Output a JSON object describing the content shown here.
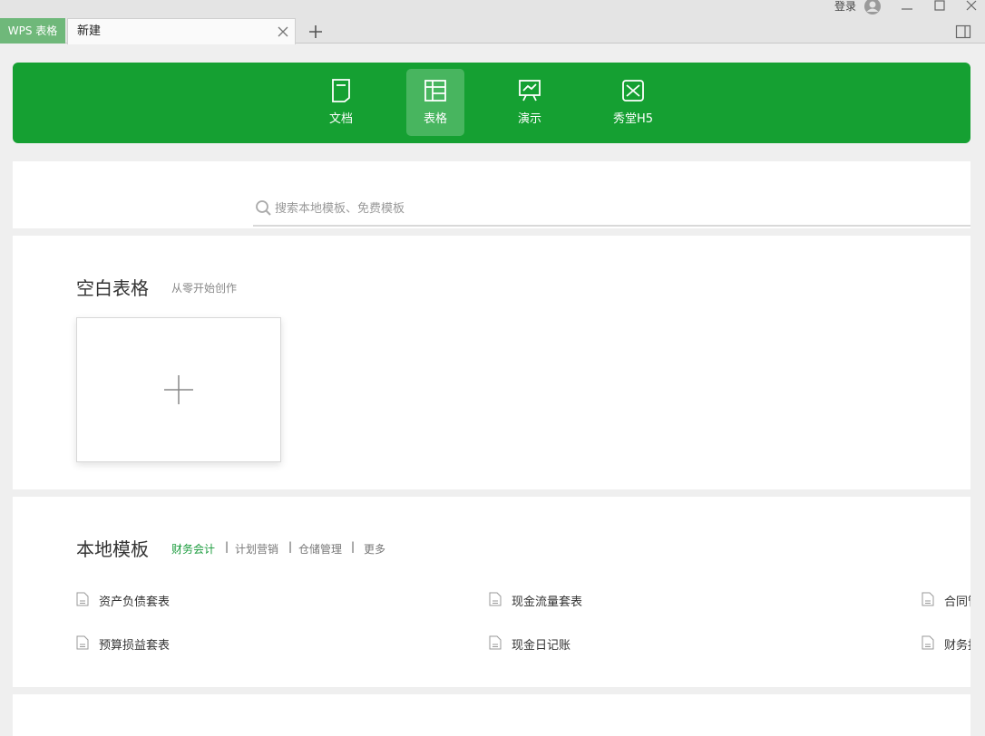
{
  "titlebar": {
    "app_tab_label": "WPS 表格",
    "doc_tab_label": "新建",
    "login_label": "登录"
  },
  "nav": {
    "items": [
      {
        "label": "文档",
        "icon": "document-icon",
        "active": false
      },
      {
        "label": "表格",
        "icon": "spreadsheet-icon",
        "active": true
      },
      {
        "label": "演示",
        "icon": "presentation-icon",
        "active": false
      },
      {
        "label": "秀堂H5",
        "icon": "h5-icon",
        "active": false
      }
    ]
  },
  "search": {
    "placeholder": "搜索本地模板、免费模板"
  },
  "blank": {
    "title": "空白表格",
    "subtitle": "从零开始创作"
  },
  "local": {
    "title": "本地模板",
    "categories": [
      "财务会计",
      "计划营销",
      "仓储管理",
      "更多"
    ],
    "active_category": "财务会计",
    "templates": [
      {
        "name": "资产负债套表"
      },
      {
        "name": "现金流量套表"
      },
      {
        "name": "合同管理"
      },
      {
        "name": "预算损益套表"
      },
      {
        "name": "现金日记账"
      },
      {
        "name": "财务报表"
      }
    ]
  },
  "colors": {
    "brand_green": "#15a032",
    "active_category": "#1a9b3c",
    "app_tab": "#6fb87a"
  }
}
